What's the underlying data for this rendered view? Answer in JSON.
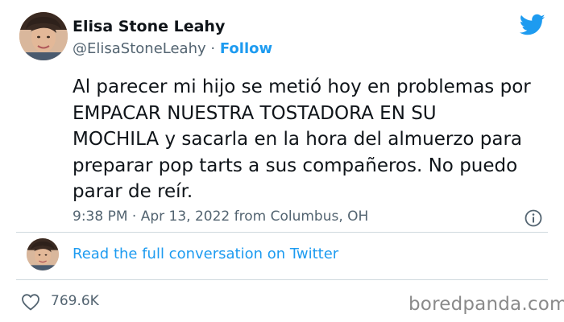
{
  "user": {
    "name": "Elisa Stone Leahy",
    "handle": "@ElisaStoneLeahy",
    "separator": "·",
    "follow_label": "Follow"
  },
  "tweet": {
    "lines": [
      "Al parecer mi hijo se metió hoy en problemas por",
      "EMPACAR NUESTRA TOSTADORA EN SU",
      "MOCHILA y sacarla en la hora del almuerzo para",
      "preparar pop tarts a sus compañeros. No puedo",
      "parar de reír."
    ],
    "meta": "9:38 PM · Apr 13, 2022 from Columbus, OH"
  },
  "conversation": {
    "link_label": "Read the full conversation on Twitter"
  },
  "stats": {
    "likes": "769.6K"
  },
  "watermark": "boredpanda.com",
  "icons": {
    "brand": "twitter-bird-icon",
    "info": "info-icon",
    "like": "heart-icon"
  },
  "colors": {
    "accent": "#1d9bf0",
    "text": "#0f1419",
    "secondary": "#536471",
    "divider": "#cfd9de"
  }
}
